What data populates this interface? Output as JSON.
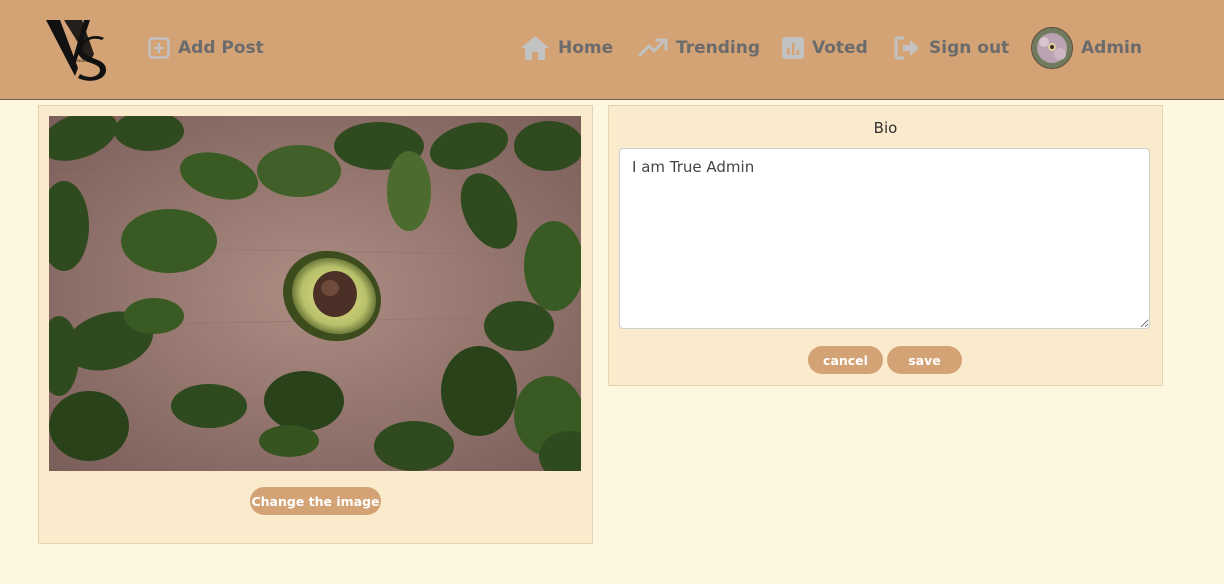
{
  "nav": {
    "logo_text": "VS",
    "add_post": "Add Post",
    "home": "Home",
    "trending": "Trending",
    "voted": "Voted",
    "sign_out": "Sign out",
    "user": "Admin"
  },
  "profile": {
    "change_image": "Change the image"
  },
  "bio": {
    "label": "Bio",
    "text": "I am True Admin",
    "cancel": "cancel",
    "save": "save"
  },
  "icons": [
    "plus-square-icon",
    "home-icon",
    "trending-icon",
    "bar-chart-icon",
    "sign-out-icon"
  ],
  "colors": {
    "navbar": "#d3a376",
    "background": "#fef7df",
    "card": "#f9ebcb",
    "button": "#d3a376",
    "nav_text": "#6b6b6b"
  }
}
